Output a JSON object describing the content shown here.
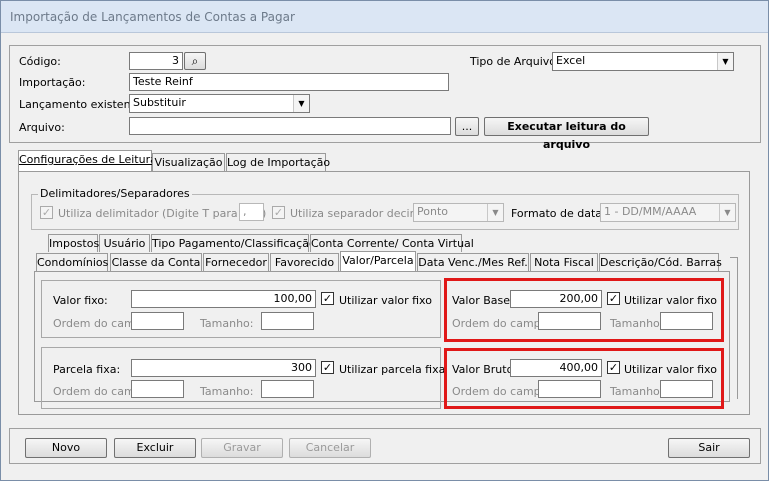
{
  "window": {
    "title": "Importação de Lançamentos de Contas a Pagar"
  },
  "form": {
    "codigo_label": "Código:",
    "codigo_value": "3",
    "tipo_arquivo_label": "Tipo de Arquivo:",
    "tipo_arquivo_value": "Excel",
    "importacao_label": "Importação:",
    "importacao_value": "Teste Reinf",
    "lancamento_label": "Lançamento existente:",
    "lancamento_value": "Substituir",
    "arquivo_label": "Arquivo:",
    "arquivo_value": "",
    "browse_label": "...",
    "executar_label": "Executar leitura do arquivo"
  },
  "main_tabs": [
    "Configurações de Leitura",
    "Visualização",
    "Log de Importação"
  ],
  "delimitadores": {
    "group_label": "Delimitadores/Separadores",
    "usa_delim_label": "Utiliza delimitador (Digite T para TAB)",
    "usa_delim_value": ",",
    "usa_sep_label": "Utiliza separador decimal",
    "sep_value": "Ponto",
    "formato_label": "Formato de data:",
    "formato_value": "1 - DD/MM/AAAA"
  },
  "sub_tabs_row1": [
    "Impostos",
    "Usuário",
    "Tipo Pagamento/Classificação",
    "Conta Corrente/ Conta Virtual"
  ],
  "sub_tabs_row2": [
    "Condomínios",
    "Classe da Conta",
    "Fornecedor",
    "Favorecido",
    "Valor/Parcela",
    "Data Venc./Mes Ref.",
    "Nota Fiscal",
    "Descrição/Cód. Barras"
  ],
  "valor_fixo": {
    "label": "Valor fixo:",
    "value": "100,00",
    "check_label": "Utilizar valor fixo",
    "ordem_label": "Ordem do campo:",
    "tamanho_label": "Tamanho:"
  },
  "parcela_fixa": {
    "label": "Parcela fixa:",
    "value": "300",
    "check_label": "Utilizar parcela fixa",
    "ordem_label": "Ordem do campo:",
    "tamanho_label": "Tamanho:"
  },
  "valor_base": {
    "label": "Valor Base:",
    "value": "200,00",
    "check_label": "Utilizar valor fixo",
    "ordem_label": "Ordem do campo:",
    "tamanho_label": "Tamanho:"
  },
  "valor_bruto": {
    "label": "Valor Bruto:",
    "value": "400,00",
    "check_label": "Utilizar valor fixo",
    "ordem_label": "Ordem do campo:",
    "tamanho_label": "Tamanho:"
  },
  "buttons": {
    "novo": "Novo",
    "excluir": "Excluir",
    "gravar": "Gravar",
    "cancelar": "Cancelar",
    "sair": "Sair"
  },
  "colors": {
    "highlight": "#e01818"
  }
}
